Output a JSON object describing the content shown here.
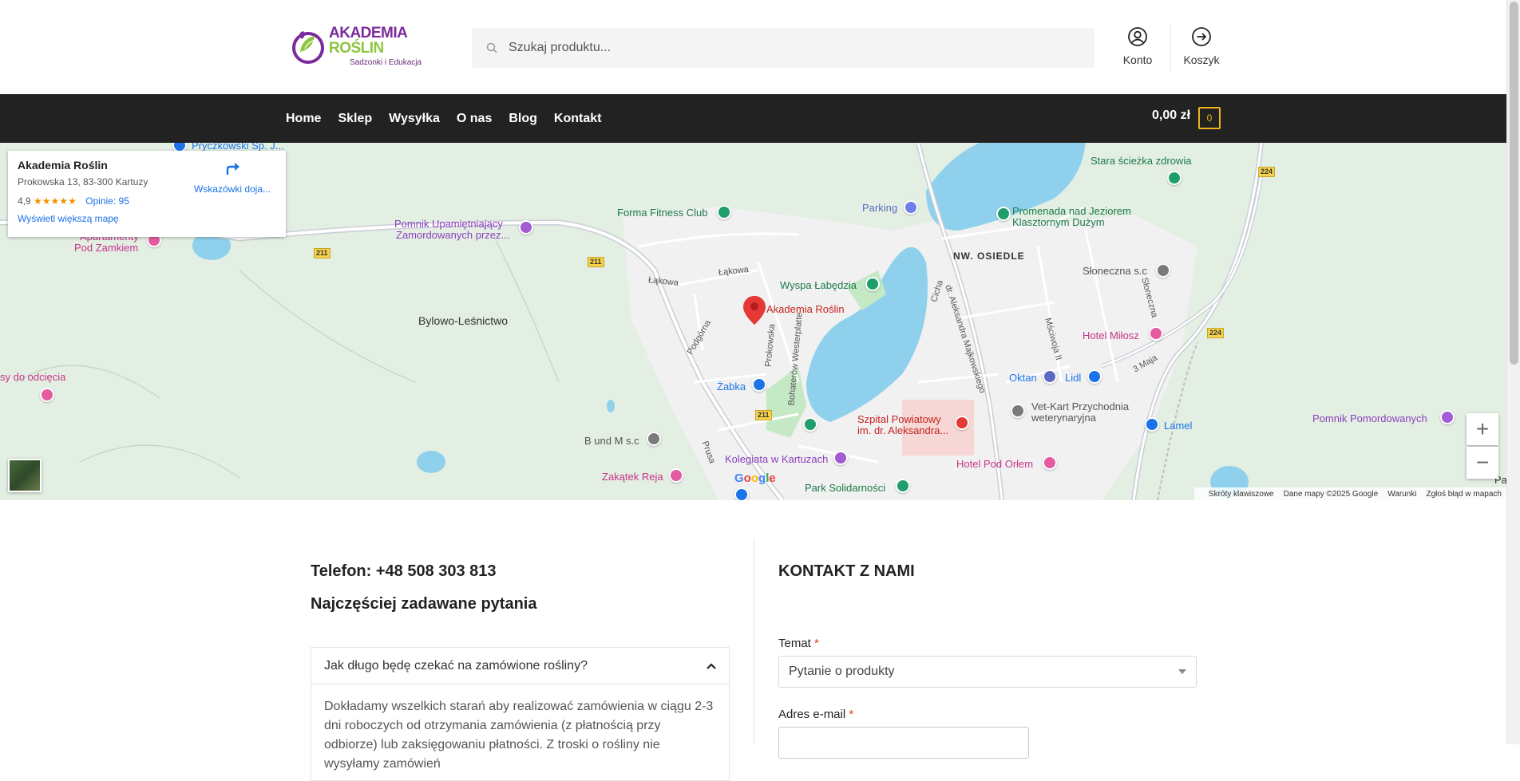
{
  "header": {
    "logo": {
      "brand_a": "AKADEMIA ",
      "brand_b": "ROŚLIN",
      "tagline": "Sadzonki i Edukacja"
    },
    "search_placeholder": "Szukaj produktu...",
    "account_label": "Konto",
    "cart_label": "Koszyk"
  },
  "nav": {
    "items": [
      "Home",
      "Sklep",
      "Wysyłka",
      "O nas",
      "Blog",
      "Kontakt"
    ],
    "cart_total": "0,00 zł",
    "cart_count": "0"
  },
  "map": {
    "infocard": {
      "title": "Akademia Roślin",
      "address": "Prokowska 13, 83-300 Kartuzy",
      "rating": "4,9",
      "stars": "★★★★★",
      "reviews": "Opinie: 95",
      "directions": "Wskazówki doja...",
      "larger_map": "Wyświetl większą mapę"
    },
    "labels": {
      "pryczkowski": "Pryczkowski Sp. J...",
      "apartamenty_1": "Apartamenty",
      "apartamenty_2": "Pod Zamkiem",
      "pomnik_1": "Pomnik Upamiętniający",
      "pomnik_2": "Zamordowanych przez...",
      "forma": "Forma Fitness Club",
      "parking": "Parking",
      "stara": "Stara ścieżka zdrowia",
      "promenada_1": "Promenada nad Jeziorem",
      "promenada_2": "Klasztornym Dużym",
      "nw_osiedle": "NW. OSIEDLE",
      "sloneczna_sc": "Słoneczna s.c",
      "lakowa_1": "Łąkowa",
      "lakowa_2": "Łąkowa",
      "wyspa": "Wyspa Łabędzia",
      "bylowo": "Bylowo-Leśnictwo",
      "akademia": "Akademia Roślin",
      "hotel_milosz": "Hotel Miłosz",
      "sy_odciecia": "sy do odcięcia",
      "oktan": "Oktan",
      "lidl": "Lidl",
      "zabka": "Żabka",
      "vetkart_1": "Vet-Kart Przychodnia",
      "vetkart_2": "weterynaryjna",
      "lamel": "Lamel",
      "pomnik_pom": "Pomnik Pomordowanych",
      "szpital_1": "Szpital Powiatowy",
      "szpital_2": "im. dr. Aleksandra...",
      "b_und_m": "B und M s.c",
      "kolegiata": "Kolegiata w Kartuzach",
      "zakatek": "Zakątek Reja",
      "hotel_orlem": "Hotel Pod Orłem",
      "park": "Park Solidarności",
      "podgorna": "Podgórna",
      "prokowska": "Prokowska",
      "westerplatte": "Bohaterów Westerplatte",
      "majkowskiego": "dr. Aleksandra Majkowskiego",
      "cicha": "Cicha",
      "mscwoja": "Mściwoja II",
      "sloneczna_st": "Słoneczna",
      "trzeciego_maja": "3 Maja",
      "prusa": "Prusa",
      "pa": "Pa",
      "r211_a": "211",
      "r211_b": "211",
      "r211_c": "211",
      "r224_a": "224",
      "r224_b": "224"
    },
    "google": "Google",
    "attribution": {
      "shortcuts": "Skróty klawiszowe",
      "data": "Dane mapy ©2025 Google",
      "terms": "Warunki",
      "report": "Zgłoś błąd w mapach"
    },
    "zoom_in": "+",
    "zoom_out": "−"
  },
  "content": {
    "phone": "Telefon: +48 508 303 813",
    "faq_heading": "Najczęściej zadawane pytania",
    "faq_question": "Jak długo będę czekać na zamówione rośliny?",
    "faq_answer": "Dokładamy wszelkich starań aby realizować zamówienia w ciągu 2-3 dni roboczych od otrzymania zamówienia (z płatnością przy odbiorze) lub zaksięgowaniu płatności. Z troski o rośliny nie wysyłamy zamówień",
    "contact_heading": "KONTAKT Z NAMI",
    "subject_label": "Temat",
    "subject_value": "Pytanie o produkty",
    "email_label": "Adres e-mail",
    "required_mark": "*"
  },
  "colors": {
    "nav_bg": "#222222",
    "cart_accent": "#f1b21a",
    "water": "#8fd1ec",
    "park": "#c5e8c5",
    "town": "#f1f1f1"
  }
}
